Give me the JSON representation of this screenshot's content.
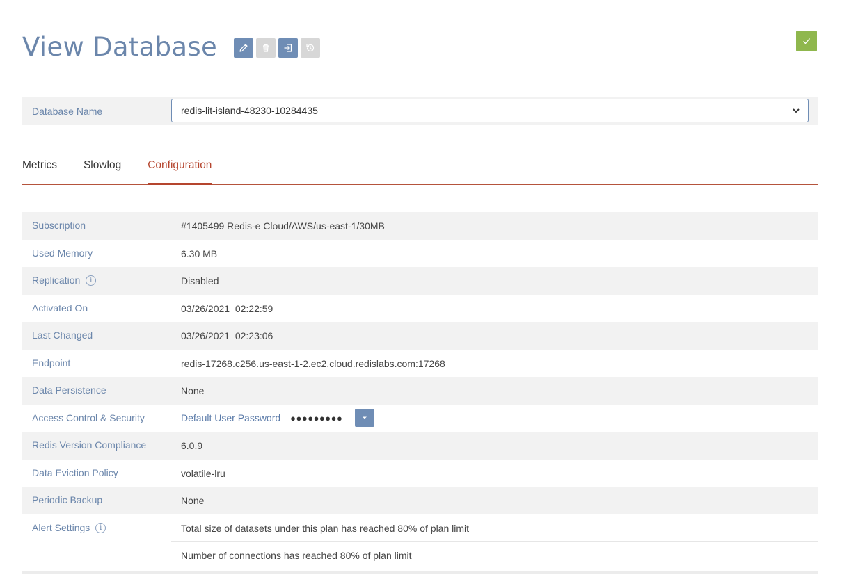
{
  "header": {
    "title": "View Database",
    "actions": [
      {
        "name": "edit-icon",
        "state": "active"
      },
      {
        "name": "delete-icon",
        "state": "disabled"
      },
      {
        "name": "import-icon",
        "state": "active"
      },
      {
        "name": "restore-icon",
        "state": "disabled"
      }
    ],
    "confirm_icon": "check-icon"
  },
  "database": {
    "label": "Database Name",
    "selected": "redis-lit-island-48230-10284435"
  },
  "tabs": [
    {
      "label": "Metrics",
      "active": false
    },
    {
      "label": "Slowlog",
      "active": false
    },
    {
      "label": "Configuration",
      "active": true
    }
  ],
  "config": {
    "subscription": {
      "label": "Subscription",
      "value": "#1405499 Redis-e Cloud/AWS/us-east-1/30MB"
    },
    "used_memory": {
      "label": "Used Memory",
      "value": "6.30 MB"
    },
    "replication": {
      "label": "Replication",
      "value": "Disabled"
    },
    "activated_on": {
      "label": "Activated On",
      "value": "03/26/2021  02:22:59"
    },
    "last_changed": {
      "label": "Last Changed",
      "value": "03/26/2021  02:23:06"
    },
    "endpoint": {
      "label": "Endpoint",
      "value": "redis-17268.c256.us-east-1-2.ec2.cloud.redislabs.com:17268"
    },
    "data_persistence": {
      "label": "Data Persistence",
      "value": "None"
    },
    "access_control": {
      "label": "Access Control & Security",
      "password_label": "Default User Password",
      "password_mask": "●●●●●●●●●"
    },
    "redis_version": {
      "label": "Redis Version Compliance",
      "value": "6.0.9"
    },
    "eviction_policy": {
      "label": "Data Eviction Policy",
      "value": "volatile-lru"
    },
    "periodic_backup": {
      "label": "Periodic Backup",
      "value": "None"
    },
    "alert_settings": {
      "label": "Alert Settings",
      "values": [
        "Total size of datasets under this plan has reached 80% of plan limit",
        "Number of connections has reached 80% of plan limit"
      ]
    }
  },
  "colors": {
    "label_blue": "#6b86ab",
    "accent_red": "#b5452e",
    "button_blue": "#6f8db5",
    "confirm_green": "#8fb74d"
  }
}
